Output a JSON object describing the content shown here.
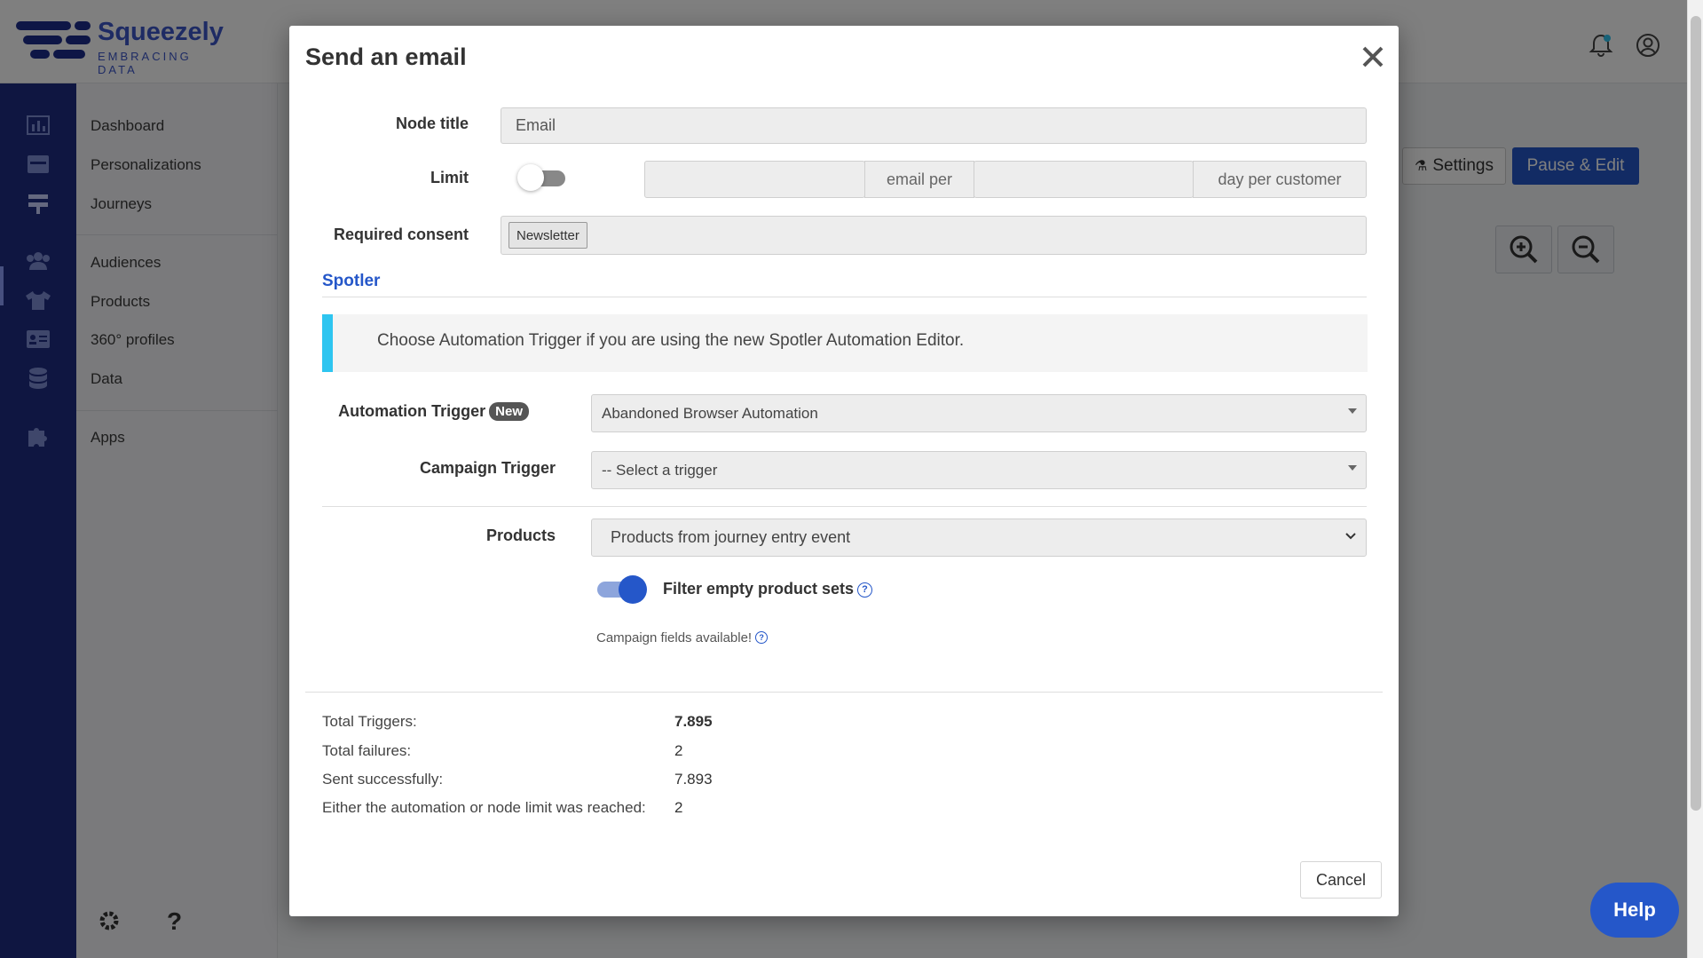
{
  "app": {
    "logo_name": "Squeezely",
    "logo_tagline": "EMBRACING DATA"
  },
  "nav": {
    "items": [
      "Dashboard",
      "Personalizations",
      "Journeys",
      "Audiences",
      "Products",
      "360° profiles",
      "Data",
      "Apps"
    ],
    "active": "Journeys"
  },
  "background": {
    "settings_label": "Settings",
    "pause_edit_label": "Pause & Edit"
  },
  "modal": {
    "title": "Send an email",
    "node_title_label": "Node title",
    "node_title_value": "Email",
    "limit_label": "Limit",
    "limit_enabled": false,
    "limit_email_addon": "email per",
    "limit_day_addon": "day per customer",
    "required_consent_label": "Required consent",
    "consent_tag": "Newsletter",
    "section_title": "Spotler",
    "callout_text": "Choose Automation Trigger if you are using the new Spotler Automation Editor.",
    "automation_trigger_label": "Automation Trigger",
    "new_badge": "New",
    "automation_trigger_value": "Abandoned Browser Automation",
    "campaign_trigger_label": "Campaign Trigger",
    "campaign_trigger_value": "-- Select a trigger",
    "products_label": "Products",
    "products_value": "Products from journey entry event",
    "filter_label": "Filter empty product sets",
    "filter_enabled": true,
    "campaign_fields_text": "Campaign fields available!",
    "stats": [
      {
        "label": "Total Triggers:",
        "value": "7.895"
      },
      {
        "label": "Total failures:",
        "value": "2"
      },
      {
        "label": "Sent successfully:",
        "value": "7.893"
      },
      {
        "label": "Either the automation or node limit was reached:",
        "value": "2"
      }
    ],
    "cancel_label": "Cancel"
  },
  "help_label": "Help",
  "colors": {
    "primary": "#2557c9",
    "sidebar": "#1f2c82",
    "callout_accent": "#2ec5f0"
  }
}
